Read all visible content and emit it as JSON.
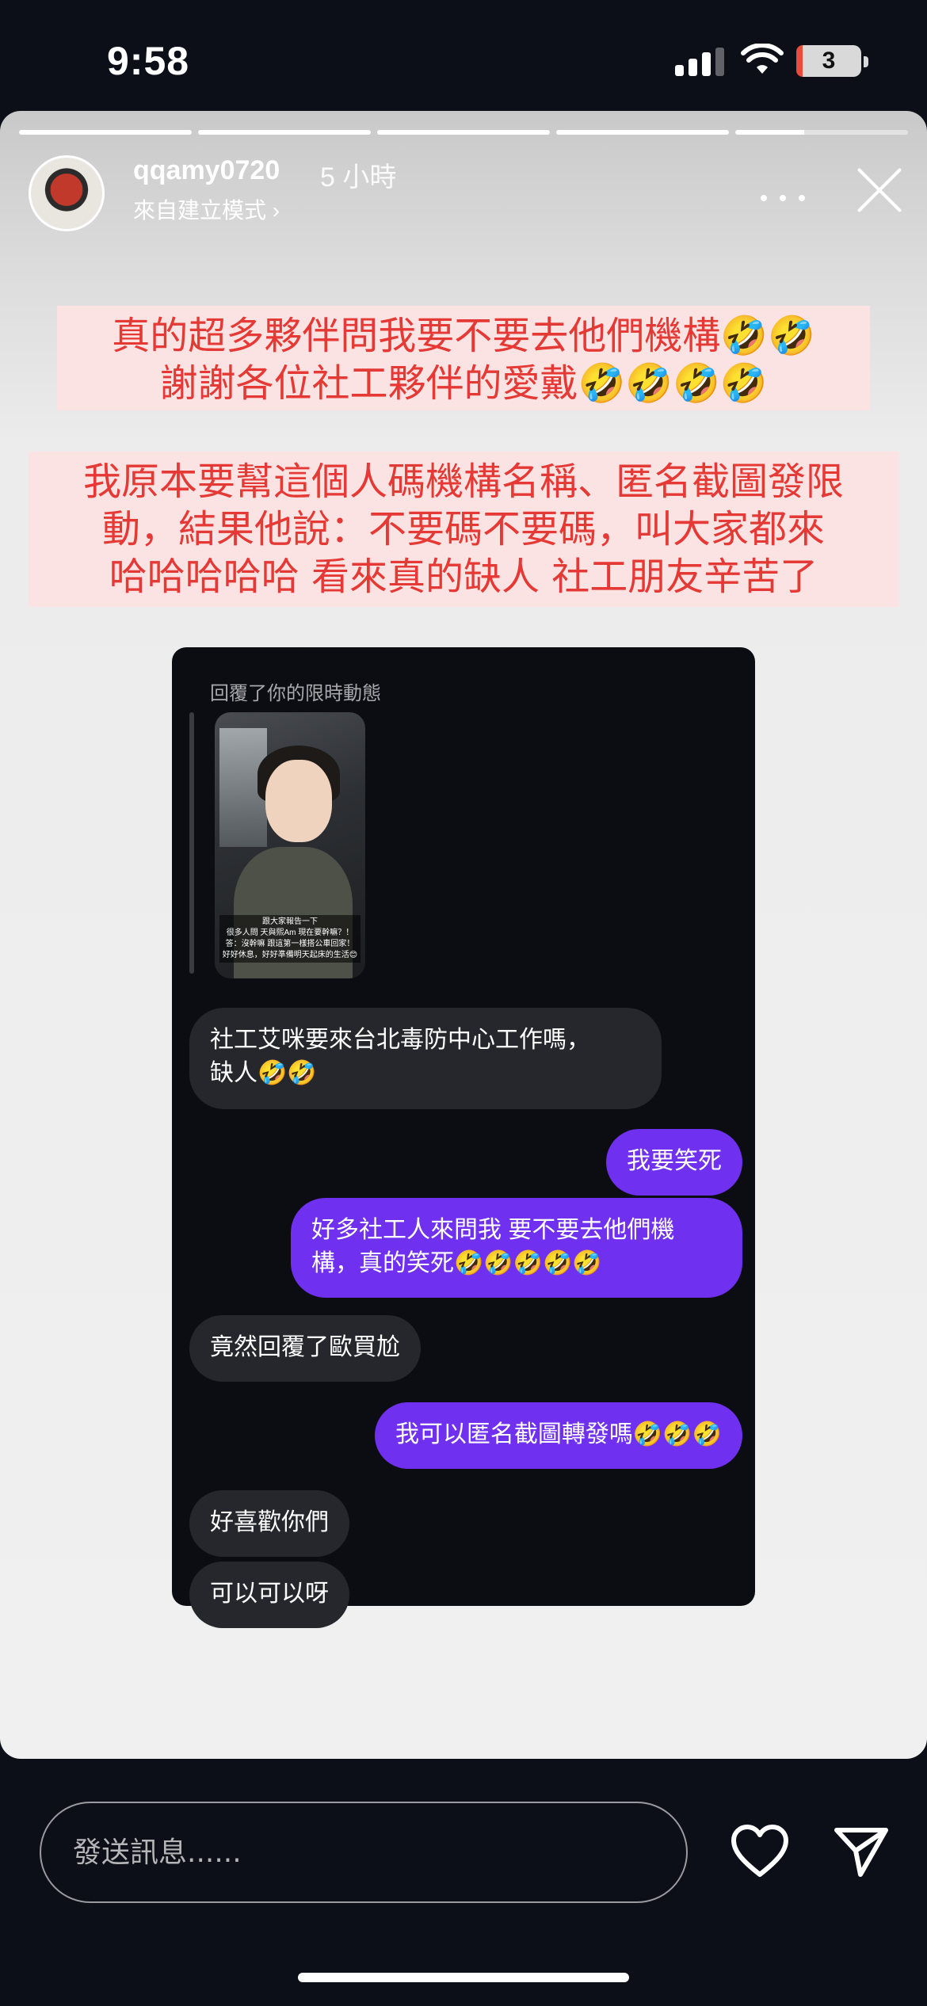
{
  "status_bar": {
    "time": "9:58",
    "battery_level": "3"
  },
  "story": {
    "progress_segments": 5,
    "username": "qqamy0720",
    "posted_ago": "5 小時",
    "source_label": "來自建立模式 ›",
    "caption_1": "真的超多夥伴問我要不要去他們機構🤣🤣\n謝謝各位社工夥伴的愛戴🤣🤣🤣🤣",
    "caption_2": "我原本要幫這個人碼機構名稱、匿名截圖發限\n動，結果他說：不要碼不要碼，叫大家都來\n哈哈哈哈哈 看來真的缺人 社工朋友辛苦了"
  },
  "dm": {
    "reply_label": "回覆了你的限時動態",
    "thumbnail_text": "跟大家報告一下\n很多人問 天與熙Am 現在要幹嘛？！\n答：沒幹嘛 跟這第一樣搭公車回家！\n好好休息，好好準備明天起床的生活😊",
    "messages": [
      {
        "side": "in",
        "text": "社工艾咪要來台北毒防中心工作嗎，\n缺人🤣🤣"
      },
      {
        "side": "out",
        "text": "我要笑死"
      },
      {
        "side": "out",
        "text": "好多社工人來問我 要不要去他們機\n構，真的笑死🤣🤣🤣🤣🤣"
      },
      {
        "side": "in",
        "text": "竟然回覆了歐買尬"
      },
      {
        "side": "out",
        "text": "我可以匿名截圖轉發嗎🤣🤣🤣"
      },
      {
        "side": "in",
        "text": "好喜歡你們"
      },
      {
        "side": "in",
        "text": "可以可以呀"
      }
    ]
  },
  "bottom_bar": {
    "input_placeholder": "發送訊息......",
    "like_icon": "heart-icon",
    "share_icon": "send-icon"
  },
  "colors": {
    "caption_text": "#e53935",
    "caption_background": "#fbe3e3",
    "outgoing_bubble": "#7030f0",
    "incoming_bubble": "#26272c"
  }
}
